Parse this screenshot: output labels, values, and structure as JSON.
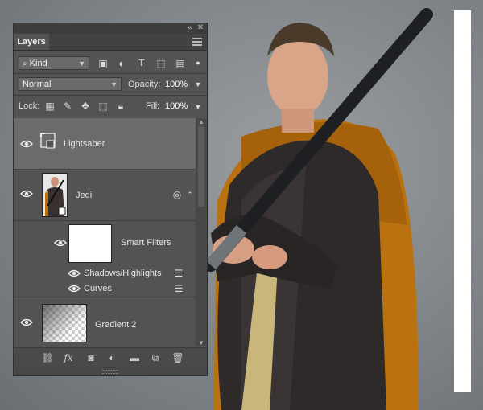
{
  "panel": {
    "tab_label": "Layers",
    "collapse_glyph": "«",
    "close_glyph": "✕",
    "filter": {
      "selected": "Kind",
      "icons": [
        "image-filter-icon",
        "adjustment-filter-icon",
        "type-filter-icon",
        "shape-filter-icon",
        "smart-object-filter-icon"
      ]
    },
    "blend_mode": "Normal",
    "opacity_label": "Opacity:",
    "opacity_value": "100%",
    "lock_label": "Lock:",
    "fill_label": "Fill:",
    "fill_value": "100%"
  },
  "layers": [
    {
      "name": "Lightsaber",
      "type": "smart-object",
      "visible": true,
      "selected": true
    },
    {
      "name": "Jedi",
      "type": "smart-object",
      "visible": true,
      "selected": false,
      "smart_filters": {
        "label": "Smart Filters",
        "items": [
          {
            "name": "Shadows/Highlights"
          },
          {
            "name": "Curves"
          }
        ]
      }
    },
    {
      "name": "Gradient 2",
      "type": "layer",
      "visible": true,
      "selected": false
    }
  ],
  "bottom_icons": [
    "link-icon",
    "fx-icon",
    "mask-icon",
    "adjustment-icon",
    "folder-icon",
    "new-layer-icon",
    "trash-icon"
  ],
  "colors": {
    "panel_bg": "#535353",
    "selected_row": "#6b6b6b",
    "cloak": "#b9720f",
    "robe": "#2f2a2a"
  }
}
